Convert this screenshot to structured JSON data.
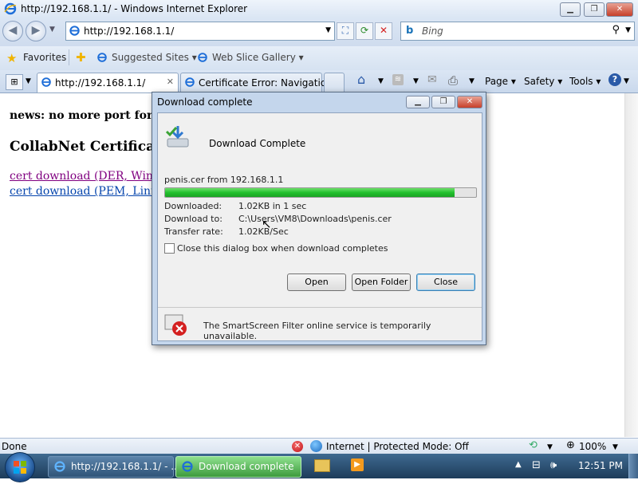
{
  "window": {
    "title": "http://192.168.1.1/ - Windows Internet Explorer",
    "controls": {
      "minimize": "▁",
      "maximize": "❐",
      "close": "✕"
    }
  },
  "address_bar": {
    "url": "http://192.168.1.1/",
    "search_placeholder": "Bing"
  },
  "favorites_bar": {
    "favorites_label": "Favorites",
    "items": [
      "Suggested Sites ▾",
      "Web Slice Gallery ▾"
    ]
  },
  "tabs": [
    {
      "label": "http://192.168.1.1/",
      "active": true
    },
    {
      "label": "Certificate Error: Navigatio...",
      "active": false
    }
  ],
  "command_bar": {
    "page": "Page ▾",
    "safety": "Safety ▾",
    "tools": "Tools ▾"
  },
  "page": {
    "news": "news: no more port forward",
    "heading": "CollabNet Certificates",
    "links": [
      "cert download (DER, Window",
      "cert download (PEM, Linux)"
    ]
  },
  "dialog": {
    "title": "Download complete",
    "header_text": "Download Complete",
    "file_line": "penis.cer from 192.168.1.1",
    "progress": 0.93,
    "rows": [
      {
        "label": "Downloaded:",
        "value": "1.02KB in 1 sec"
      },
      {
        "label": "Download to:",
        "value": "C:\\Users\\VM8\\Downloads\\penis.cer"
      },
      {
        "label": "Transfer rate:",
        "value": "1.02KB/Sec"
      }
    ],
    "checkbox_label": "Close this dialog box when download completes",
    "buttons": {
      "open": "Open",
      "open_folder": "Open Folder",
      "close": "Close"
    },
    "smartscreen_msg": "The SmartScreen Filter online service is temporarily unavailable."
  },
  "status_bar": {
    "left": "Done",
    "zone": "Internet | Protected Mode: Off",
    "zoom": "100%"
  },
  "taskbar": {
    "buttons": [
      "http://192.168.1.1/ - ...",
      "Download complete"
    ],
    "clock": "12:51 PM"
  },
  "colors": {
    "link": "#0645ad",
    "visited_link": "#800080",
    "progress": "#22c12e",
    "accent": "#2a5aa8"
  }
}
